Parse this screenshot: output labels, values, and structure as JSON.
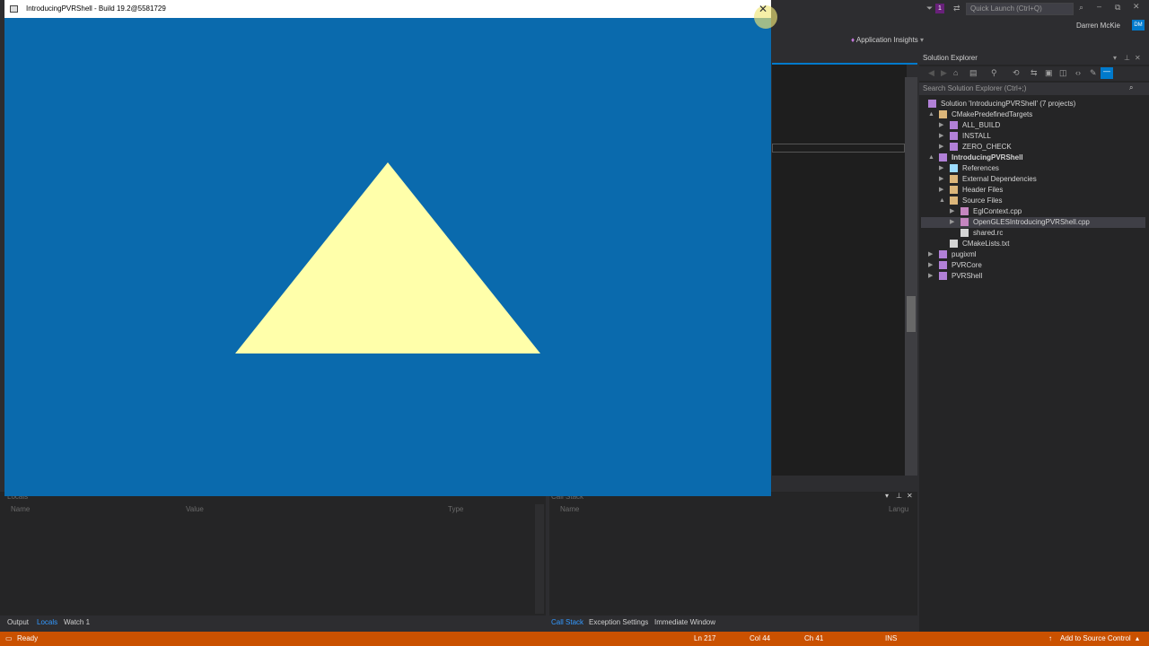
{
  "app_window": {
    "title": "IntroducingPVRShell - Build 19.2@5581729",
    "background_color": "#0a6aad",
    "triangle_color": "#ffffaa"
  },
  "vs": {
    "quick_launch_placeholder": "Quick Launch (Ctrl+Q)",
    "notification_count": "1",
    "user_name": "Darren McKie",
    "user_initials": "DM",
    "app_insights": "Application Insights"
  },
  "solution_explorer": {
    "title": "Solution Explorer",
    "search_placeholder": "Search Solution Explorer (Ctrl+;)",
    "items": [
      {
        "label": "Solution 'IntroducingPVRShell' (7 projects)"
      },
      {
        "label": "CMakePredefinedTargets"
      },
      {
        "label": "ALL_BUILD"
      },
      {
        "label": "INSTALL"
      },
      {
        "label": "ZERO_CHECK"
      },
      {
        "label": "IntroducingPVRShell"
      },
      {
        "label": "References"
      },
      {
        "label": "External Dependencies"
      },
      {
        "label": "Header Files"
      },
      {
        "label": "Source Files"
      },
      {
        "label": "EglContext.cpp"
      },
      {
        "label": "OpenGLESIntroducingPVRShell.cpp"
      },
      {
        "label": "shared.rc"
      },
      {
        "label": "CMakeLists.txt"
      },
      {
        "label": "pugixml"
      },
      {
        "label": "PVRCore"
      },
      {
        "label": "PVRShell"
      }
    ]
  },
  "locals_panel": {
    "title": "Locals",
    "columns": [
      "Name",
      "Value",
      "Type"
    ]
  },
  "callstack_panel": {
    "title": "Call Stack",
    "columns": [
      "Name",
      "Langu"
    ]
  },
  "bottom_tabs_left": [
    "Output",
    "Locals",
    "Watch 1"
  ],
  "bottom_tabs_right": [
    "Call Stack",
    "Exception Settings",
    "Immediate Window"
  ],
  "status_bar": {
    "state": "Ready",
    "line": "Ln 217",
    "col": "Col 44",
    "ch": "Ch 41",
    "mode": "INS",
    "source_control": "Add to Source Control"
  }
}
